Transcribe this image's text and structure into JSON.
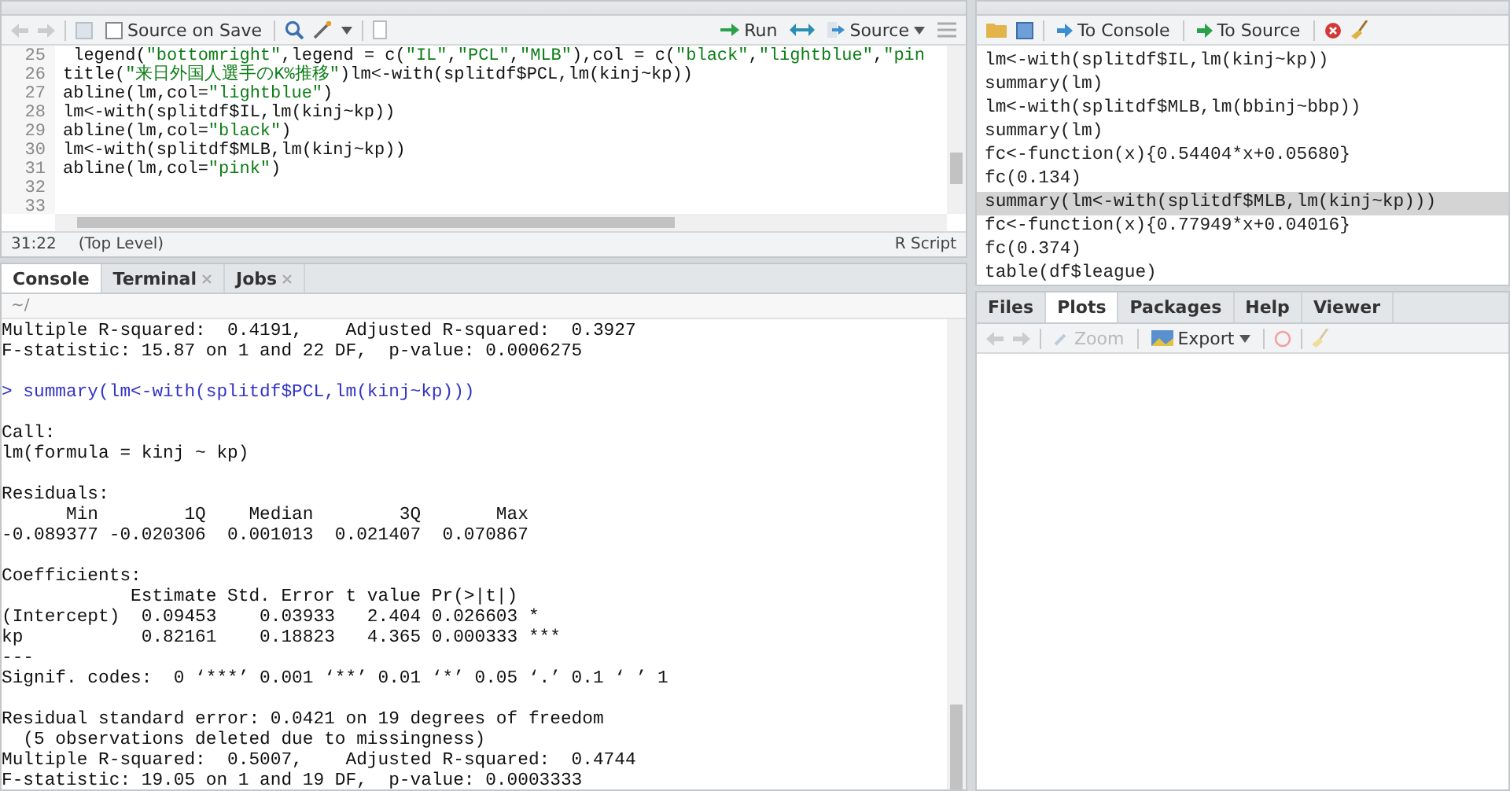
{
  "editor": {
    "toolbar": {
      "source_on_save": {
        "label": "Source on Save",
        "checked": false
      },
      "run": "Run",
      "source": "Source"
    },
    "lines": [
      {
        "number": "25",
        "tokens": [
          {
            "kind": "code",
            "text": " legend("
          },
          {
            "kind": "string",
            "text": "\"bottomright\""
          },
          {
            "kind": "code",
            "text": ",legend = c("
          },
          {
            "kind": "string",
            "text": "\"IL\""
          },
          {
            "kind": "code",
            "text": ","
          },
          {
            "kind": "string",
            "text": "\"PCL\""
          },
          {
            "kind": "code",
            "text": ","
          },
          {
            "kind": "string",
            "text": "\"MLB\""
          },
          {
            "kind": "code",
            "text": "),col = c("
          },
          {
            "kind": "string",
            "text": "\"black\""
          },
          {
            "kind": "code",
            "text": ","
          },
          {
            "kind": "string",
            "text": "\"lightblue\""
          },
          {
            "kind": "code",
            "text": ","
          },
          {
            "kind": "string",
            "text": "\"pin"
          }
        ]
      },
      {
        "number": "26",
        "tokens": [
          {
            "kind": "code",
            "text": "title("
          },
          {
            "kind": "string",
            "text": "\"来日外国人選手のK%推移\""
          },
          {
            "kind": "code",
            "text": ")lm<-with(splitdf$PCL,lm(kinj~kp))"
          }
        ]
      },
      {
        "number": "27",
        "tokens": [
          {
            "kind": "code",
            "text": "abline(lm,col="
          },
          {
            "kind": "string",
            "text": "\"lightblue\""
          },
          {
            "kind": "code",
            "text": ")"
          }
        ]
      },
      {
        "number": "28",
        "tokens": [
          {
            "kind": "code",
            "text": "lm<-with(splitdf$IL,lm(kinj~kp))"
          }
        ]
      },
      {
        "number": "29",
        "tokens": [
          {
            "kind": "code",
            "text": "abline(lm,col="
          },
          {
            "kind": "string",
            "text": "\"black\""
          },
          {
            "kind": "code",
            "text": ")"
          }
        ]
      },
      {
        "number": "30",
        "tokens": [
          {
            "kind": "code",
            "text": "lm<-with(splitdf$MLB,lm(kinj~kp))"
          }
        ]
      },
      {
        "number": "31",
        "tokens": [
          {
            "kind": "code",
            "text": "abline(lm,col="
          },
          {
            "kind": "string",
            "text": "\"pink\""
          },
          {
            "kind": "code",
            "text": ")"
          }
        ]
      },
      {
        "number": "32"
      },
      {
        "number": "33"
      }
    ],
    "status": {
      "position": "31:22",
      "scope": "(Top Level)",
      "file_type": "R Script"
    }
  },
  "console": {
    "tabs": [
      {
        "label": "Console",
        "selected": true,
        "closable": false
      },
      {
        "label": "Terminal",
        "selected": false,
        "closable": true
      },
      {
        "label": "Jobs",
        "selected": false,
        "closable": true
      }
    ],
    "path": "~/",
    "lines": [
      {
        "kind": "output",
        "text": "Multiple R-squared:  0.4191,\tAdjusted R-squared:  0.3927 "
      },
      {
        "kind": "output",
        "text": "F-statistic: 15.87 on 1 and 22 DF,  p-value: 0.0006275"
      },
      {
        "kind": "blank"
      },
      {
        "kind": "command",
        "text": "> summary(lm<-with(splitdf$PCL,lm(kinj~kp)))"
      },
      {
        "kind": "blank"
      },
      {
        "kind": "output",
        "text": "Call:"
      },
      {
        "kind": "output",
        "text": "lm(formula = kinj ~ kp)"
      },
      {
        "kind": "blank"
      },
      {
        "kind": "output",
        "text": "Residuals:"
      },
      {
        "kind": "output",
        "text": "      Min        1Q    Median        3Q       Max "
      },
      {
        "kind": "output",
        "text": "-0.089377 -0.020306  0.001013  0.021407  0.070867 "
      },
      {
        "kind": "blank"
      },
      {
        "kind": "output",
        "text": "Coefficients:"
      },
      {
        "kind": "output",
        "text": "            Estimate Std. Error t value Pr(>|t|)    "
      },
      {
        "kind": "output",
        "text": "(Intercept)  0.09453    0.03933   2.404 0.026603 *  "
      },
      {
        "kind": "output",
        "text": "kp           0.82161    0.18823   4.365 0.000333 ***"
      },
      {
        "kind": "output",
        "text": "---"
      },
      {
        "kind": "output",
        "text": "Signif. codes:  0 ‘***’ 0.001 ‘**’ 0.01 ‘*’ 0.05 ‘.’ 0.1 ‘ ’ 1"
      },
      {
        "kind": "blank"
      },
      {
        "kind": "output",
        "text": "Residual standard error: 0.0421 on 19 degrees of freedom"
      },
      {
        "kind": "output",
        "text": "  (5 observations deleted due to missingness)"
      },
      {
        "kind": "output",
        "text": "Multiple R-squared:  0.5007,\tAdjusted R-squared:  0.4744 "
      },
      {
        "kind": "output",
        "text": "F-statistic: 19.05 on 1 and 19 DF,  p-value: 0.0003333"
      }
    ]
  },
  "history": {
    "toolbar": {
      "to_console": "To Console",
      "to_source": "To Source"
    },
    "items": [
      {
        "text": "lm<-with(splitdf$IL,lm(kinj~kp))",
        "selected": false
      },
      {
        "text": "summary(lm)",
        "selected": false
      },
      {
        "text": "lm<-with(splitdf$MLB,lm(bbinj~bbp))",
        "selected": false
      },
      {
        "text": "summary(lm)",
        "selected": false
      },
      {
        "text": "fc<-function(x){0.54404*x+0.05680}",
        "selected": false
      },
      {
        "text": "fc(0.134)",
        "selected": false
      },
      {
        "text": "summary(lm<-with(splitdf$MLB,lm(kinj~kp)))",
        "selected": true
      },
      {
        "text": "fc<-function(x){0.77949*x+0.04016}",
        "selected": false
      },
      {
        "text": "fc(0.374)",
        "selected": false
      },
      {
        "text": "table(df$league)",
        "selected": false
      }
    ]
  },
  "files": {
    "tabs": [
      {
        "label": "Files",
        "selected": false
      },
      {
        "label": "Plots",
        "selected": true
      },
      {
        "label": "Packages",
        "selected": false
      },
      {
        "label": "Help",
        "selected": false
      },
      {
        "label": "Viewer",
        "selected": false
      }
    ],
    "toolbar": {
      "zoom": {
        "label": "Zoom",
        "disabled": true
      },
      "export": "Export"
    }
  }
}
